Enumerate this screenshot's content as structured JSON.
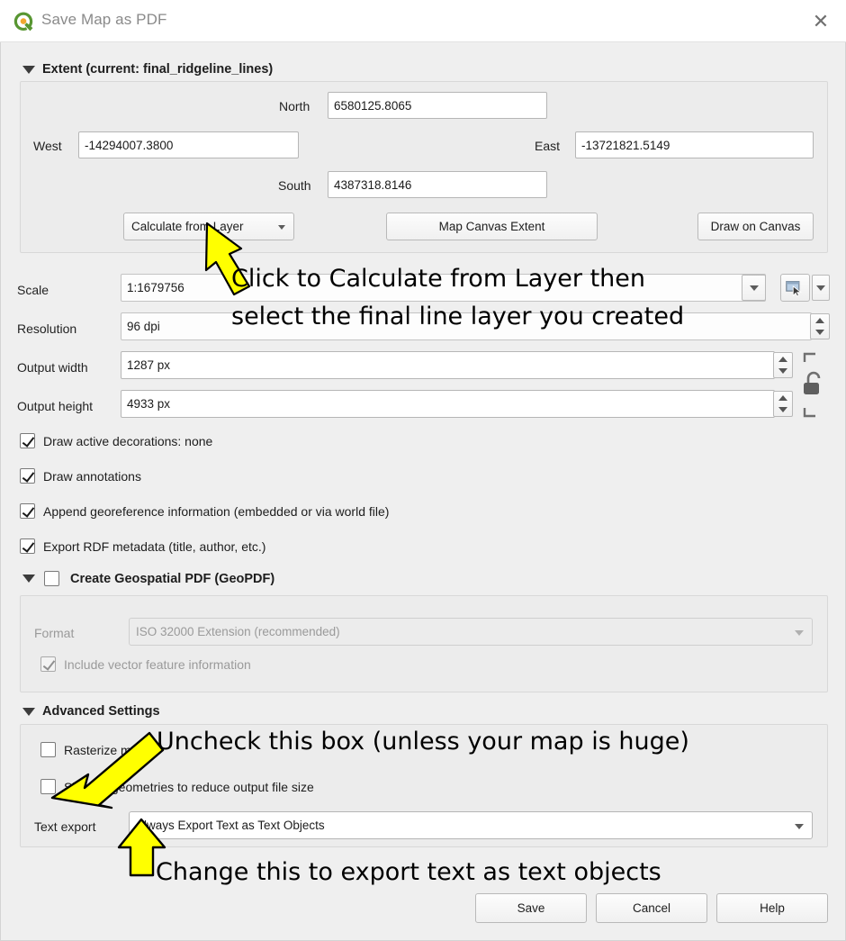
{
  "window": {
    "title": "Save Map as PDF",
    "logo_icon": "qgis-logo-icon",
    "close_icon": "close-icon"
  },
  "extent": {
    "group_label": "Extent (current: final_ridgeline_lines)",
    "north_label": "North",
    "north_value": "6580125.8065",
    "west_label": "West",
    "west_value": "-14294007.3800",
    "east_label": "East",
    "east_value": "-13721821.5149",
    "south_label": "South",
    "south_value": "4387318.8146",
    "calculate_from_layer": "Calculate from Layer",
    "map_canvas_extent": "Map Canvas Extent",
    "draw_on_canvas": "Draw on Canvas"
  },
  "settings": {
    "scale_label": "Scale",
    "scale_value": "1:1679756",
    "scale_canvas_icon": "set-to-canvas-scale-icon",
    "resolution_label": "Resolution",
    "resolution_value": "96 dpi",
    "output_width_label": "Output width",
    "output_width_value": "1287 px",
    "output_height_label": "Output height",
    "output_height_value": "4933 px",
    "lock_icon": "aspect-ratio-unlocked-icon"
  },
  "options": [
    {
      "label": "Draw active decorations: none",
      "checked": true
    },
    {
      "label": "Draw annotations",
      "checked": true
    },
    {
      "label": "Append georeference information (embedded or via world file)",
      "checked": true
    },
    {
      "label": "Export RDF metadata (title, author, etc.)",
      "checked": true
    }
  ],
  "geopdf": {
    "group_label": "Create Geospatial PDF (GeoPDF)",
    "group_checked": false,
    "format_label": "Format",
    "format_value": "ISO 32000 Extension (recommended)",
    "include_vector_label": "Include vector feature information",
    "include_vector_checked": true
  },
  "advanced": {
    "group_label": "Advanced Settings",
    "rasterize_label": "Rasterize map",
    "rasterize_checked": false,
    "simplify_label": "Simplify geometries to reduce output file size",
    "simplify_checked": false,
    "text_export_label": "Text export",
    "text_export_value": "Always Export Text as Text Objects"
  },
  "buttons": {
    "save": "Save",
    "cancel": "Cancel",
    "help": "Help"
  },
  "annotations": {
    "color": "#ffff00",
    "line1": "Click to Calculate from Layer then",
    "line2": "select the final line layer you created",
    "line3": "Uncheck this box (unless your map is huge)",
    "line4": "Change this to export text as text objects"
  }
}
